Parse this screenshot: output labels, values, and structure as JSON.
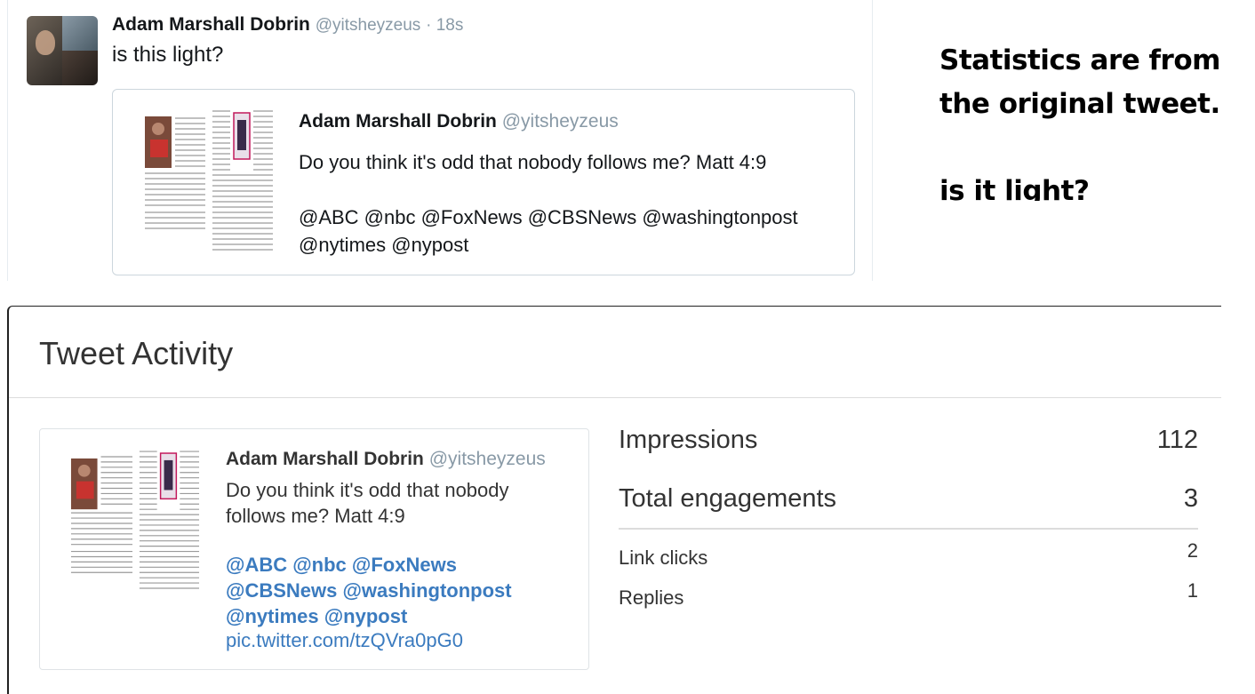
{
  "top_tweet": {
    "author_name": "Adam Marshall Dobrin",
    "author_handle": "@yitsheyzeus",
    "time": "· 18s",
    "text": "is this light?",
    "quoted": {
      "author_name": "Adam Marshall Dobrin",
      "author_handle": "@yitsheyzeus",
      "text": "Do you think it's odd that nobody follows me? Matt 4:9",
      "mentions_line1": "@ABC @nbc @FoxNews @CBSNews @washingtonpost",
      "mentions_line2": "@nytimes @nypost"
    }
  },
  "caption": {
    "line1": "Statistics are from",
    "line2": "the original tweet.",
    "line3": "is it light?"
  },
  "activity": {
    "title": "Tweet Activity",
    "tweet": {
      "author_name": "Adam Marshall Dobrin",
      "author_handle": "@yitsheyzeus",
      "text_line1": "Do you think it's odd that nobody",
      "text_line2": "follows me? Matt 4:9",
      "mentions_line1": "@ABC @nbc @FoxNews",
      "mentions_line2": "@CBSNews @washingtonpost",
      "mentions_line3": "@nytimes @nypost",
      "link": "pic.twitter.com/tzQVra0pG0"
    },
    "stats": {
      "impressions_label": "Impressions",
      "impressions_value": "112",
      "engagements_label": "Total engagements",
      "engagements_value": "3",
      "link_clicks_label": "Link clicks",
      "link_clicks_value": "2",
      "replies_label": "Replies",
      "replies_value": "1"
    }
  },
  "colors": {
    "link": "#3b7bbf",
    "handle": "#8899a6",
    "border": "#ccd6dd"
  }
}
